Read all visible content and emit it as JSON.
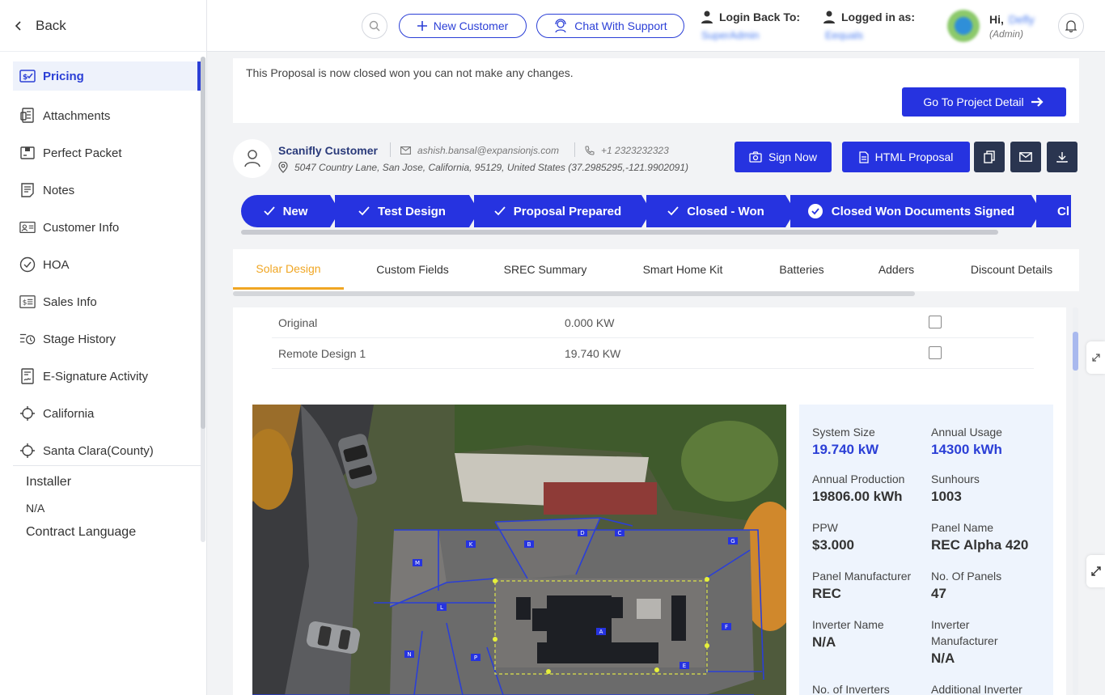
{
  "sidebar": {
    "back_label": "Back",
    "items": [
      {
        "label": "Pricing",
        "icon": "pricing-icon",
        "active": true
      },
      {
        "label": "Attachments",
        "icon": "attachments-icon"
      },
      {
        "label": "Perfect Packet",
        "icon": "packet-icon"
      },
      {
        "label": "Notes",
        "icon": "notes-icon"
      },
      {
        "label": "Customer Info",
        "icon": "customer-info-icon"
      },
      {
        "label": "HOA",
        "icon": "hoa-icon"
      },
      {
        "label": "Sales Info",
        "icon": "sales-info-icon"
      },
      {
        "label": "Stage History",
        "icon": "stage-history-icon"
      },
      {
        "label": "E-Signature Activity",
        "icon": "esignature-icon"
      },
      {
        "label": "California",
        "icon": "location-icon"
      },
      {
        "label": "Santa Clara(County)",
        "icon": "location-icon"
      }
    ],
    "installer_label": "Installer",
    "installer_value": "N/A",
    "contract_language_label": "Contract Language"
  },
  "header": {
    "new_customer": "New Customer",
    "chat_support": "Chat With Support",
    "login_back_label": "Login Back To:",
    "login_back_value": "SuperAdmin",
    "logged_in_label": "Logged in as:",
    "logged_in_value": "Eequals",
    "greeting": "Hi,",
    "user_name": "Defly",
    "user_role": "(Admin)"
  },
  "notice": {
    "text": "This Proposal is now closed won you can not make any changes.",
    "go_project": "Go To Project Detail"
  },
  "customer": {
    "name": "Scanifly Customer",
    "email": "ashish.bansal@expansionjs.com",
    "phone": "+1 2323232323",
    "address": "5047 Country Lane, San Jose, California, 95129, United States (37.2985295,-121.9902091)"
  },
  "actions": {
    "sign_now": "Sign Now",
    "html_proposal": "HTML Proposal"
  },
  "stages": [
    "New",
    "Test Design",
    "Proposal Prepared",
    "Closed - Won",
    "Closed Won Documents Signed",
    "Cl"
  ],
  "tabs": [
    "Solar Design",
    "Custom Fields",
    "SREC Summary",
    "Smart Home Kit",
    "Batteries",
    "Adders",
    "Discount Details"
  ],
  "designs": [
    {
      "name": "Original",
      "size": "0.000 KW"
    },
    {
      "name": "Remote Design 1",
      "size": "19.740 KW"
    }
  ],
  "stats": {
    "system_size_label": "System Size",
    "system_size": "19.740 kW",
    "annual_usage_label": "Annual Usage",
    "annual_usage": "14300 kWh",
    "annual_production_label": "Annual Production",
    "annual_production": "19806.00 kWh",
    "sunhours_label": "Sunhours",
    "sunhours": "1003",
    "ppw_label": "PPW",
    "ppw": "$3.000",
    "panel_name_label": "Panel Name",
    "panel_name": "REC Alpha 420",
    "panel_manufacturer_label": "Panel Manufacturer",
    "panel_manufacturer": "REC",
    "no_panels_label": "No. Of Panels",
    "no_panels": "47",
    "inverter_name_label": "Inverter Name",
    "inverter_name": "N/A",
    "inverter_manufacturer_label": "Inverter Manufacturer",
    "inverter_manufacturer": "N/A",
    "no_inverters_label": "No. of Inverters",
    "additional_inverter_label": "Additional Inverter"
  },
  "roof_labels": [
    "K",
    "B",
    "D",
    "C",
    "G",
    "M",
    "L",
    "A",
    "F",
    "N",
    "P",
    "E"
  ],
  "colors": {
    "primary": "#2633e0",
    "accent": "#f0a623",
    "dark_btn": "#2a3550"
  }
}
